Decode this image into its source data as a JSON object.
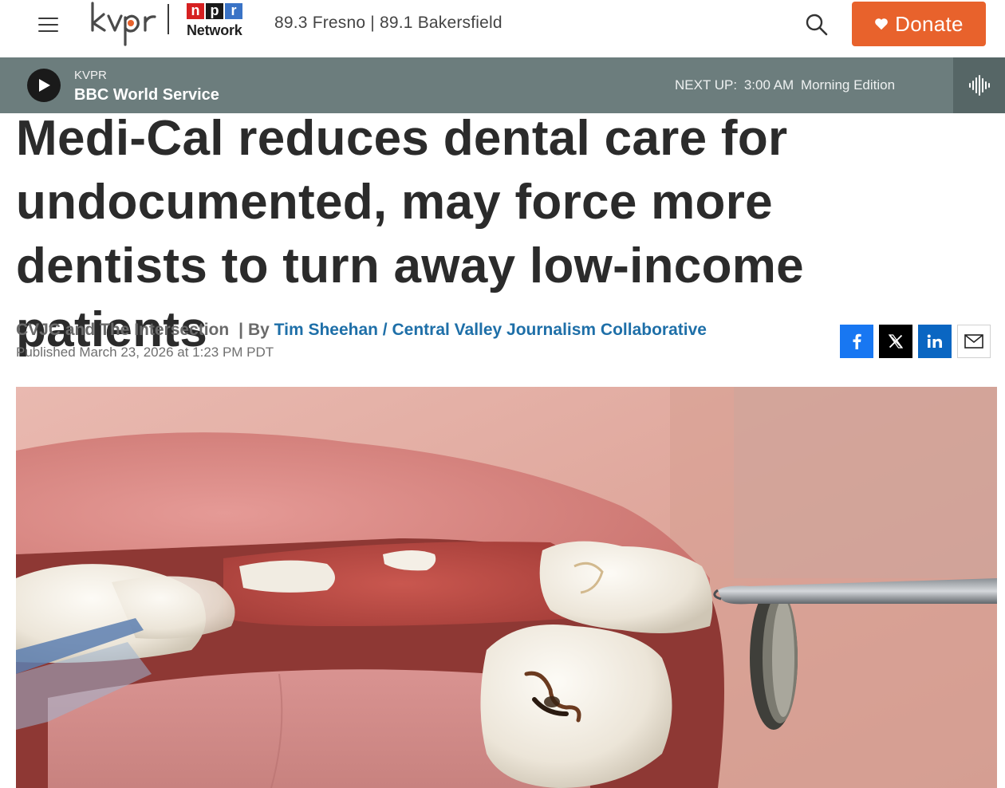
{
  "header": {
    "logo": {
      "station": "kvpr",
      "network_blocks": [
        "n",
        "p",
        "r"
      ],
      "network_label": "Network"
    },
    "station_frequencies": "89.3 Fresno | 89.1 Bakersfield",
    "donate_label": "Donate",
    "icons": {
      "menu": "hamburger-menu-icon",
      "search": "search-icon",
      "donate": "heart-icon"
    },
    "colors": {
      "donate": "#e8622c",
      "npr_n": "#d62021",
      "npr_p": "#1a1a1a",
      "npr_r": "#3a73c6"
    }
  },
  "player": {
    "station": "KVPR",
    "program": "BBC World Service",
    "next_up_label": "NEXT UP:",
    "next_up_time": "3:00 AM",
    "next_up_program": "Morning Edition",
    "icons": {
      "play": "play-icon",
      "audio": "audio-waveform-icon"
    },
    "colors": {
      "bar": "#6c7d7d",
      "audio_button": "#566666"
    }
  },
  "article": {
    "headline": "Medi-Cal reduces dental care for undocumented, may force more dentists to turn away low-income patients",
    "source": "CVJC and The Intersection",
    "byline_separator": "|",
    "byline_prefix": "By",
    "author": "Tim Sheehan / Central Valley Journalism Collaborative",
    "published": "Published March 23, 2026 at 1:23 PM PDT",
    "share": [
      {
        "network": "facebook",
        "icon": "facebook-icon"
      },
      {
        "network": "x",
        "icon": "x-icon"
      },
      {
        "network": "linkedin",
        "icon": "linkedin-icon"
      },
      {
        "network": "email",
        "icon": "email-icon"
      }
    ],
    "colors": {
      "author_link": "#1e6fa8"
    },
    "hero_image": "close-up photo of an open mouth showing a molar with a dark cavity and a dental probe"
  }
}
